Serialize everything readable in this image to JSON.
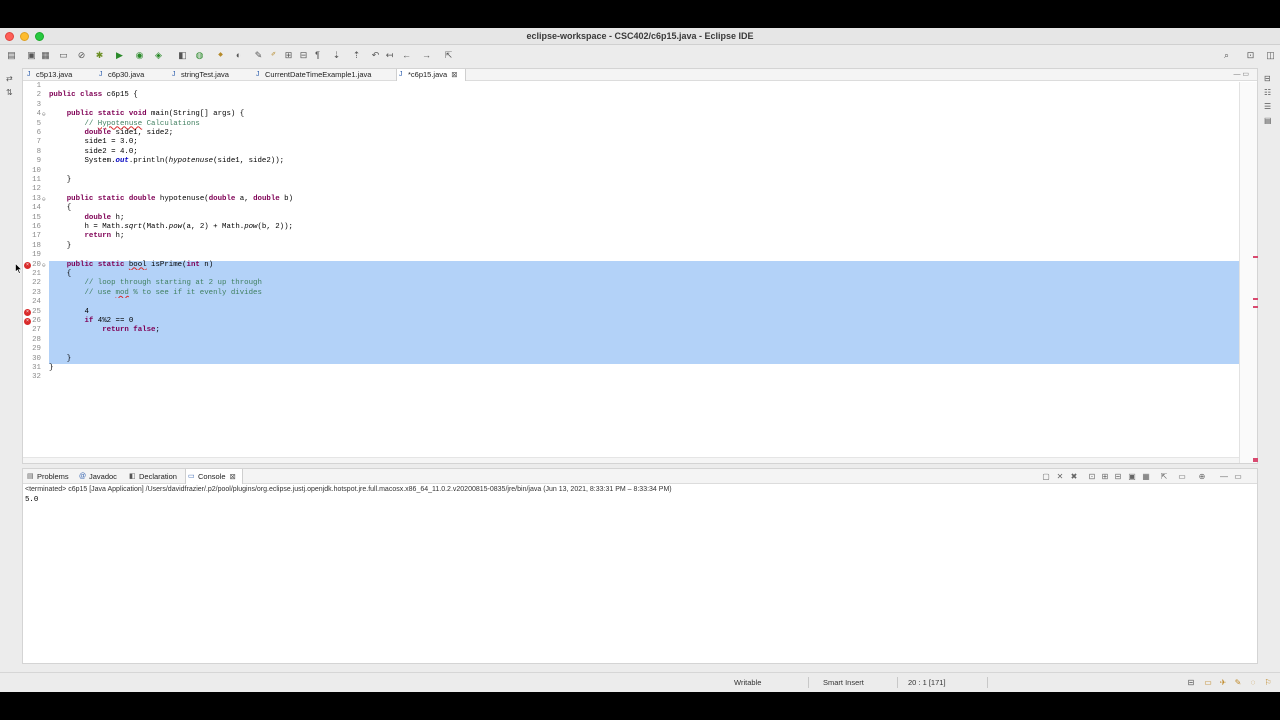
{
  "window": {
    "title": "eclipse-workspace - CSC402/c6p15.java - Eclipse IDE"
  },
  "editor": {
    "tabs": [
      {
        "label": "c5p13.java",
        "active": false
      },
      {
        "label": "c6p30.java",
        "active": false
      },
      {
        "label": "stringTest.java",
        "active": false
      },
      {
        "label": "CurrentDateTimeExample1.java",
        "active": false
      },
      {
        "label": "*c6p15.java",
        "active": true
      }
    ],
    "lines": [
      {
        "n": "1",
        "text": ""
      },
      {
        "n": "2",
        "text": "public class c6p15 {"
      },
      {
        "n": "3",
        "text": ""
      },
      {
        "n": "4",
        "text": "    public static void main(String[] args) {"
      },
      {
        "n": "5",
        "text": "        // Hypotenuse Calculations"
      },
      {
        "n": "6",
        "text": "        double side1, side2;"
      },
      {
        "n": "7",
        "text": "        side1 = 3.0;"
      },
      {
        "n": "8",
        "text": "        side2 = 4.0;"
      },
      {
        "n": "9",
        "text": "        System.out.println(hypotenuse(side1, side2));"
      },
      {
        "n": "10",
        "text": ""
      },
      {
        "n": "11",
        "text": "    }"
      },
      {
        "n": "12",
        "text": ""
      },
      {
        "n": "13",
        "text": "    public static double hypotenuse(double a, double b)"
      },
      {
        "n": "14",
        "text": "    {"
      },
      {
        "n": "15",
        "text": "        double h;"
      },
      {
        "n": "16",
        "text": "        h = Math.sqrt(Math.pow(a, 2) + Math.pow(b, 2));"
      },
      {
        "n": "17",
        "text": "        return h;"
      },
      {
        "n": "18",
        "text": "    }"
      },
      {
        "n": "19",
        "text": ""
      },
      {
        "n": "20",
        "text": "    public static bool isPrime(int n)"
      },
      {
        "n": "21",
        "text": "    {"
      },
      {
        "n": "22",
        "text": "        // loop through starting at 2 up through"
      },
      {
        "n": "23",
        "text": "        // use mod % to see if it evenly divides"
      },
      {
        "n": "24",
        "text": ""
      },
      {
        "n": "25",
        "text": "        4"
      },
      {
        "n": "26",
        "text": "        if 4%2 == 0"
      },
      {
        "n": "27",
        "text": "            return false;"
      },
      {
        "n": "28",
        "text": ""
      },
      {
        "n": "29",
        "text": ""
      },
      {
        "n": "30",
        "text": "    }"
      },
      {
        "n": "31",
        "text": "}"
      },
      {
        "n": "32",
        "text": ""
      }
    ]
  },
  "bottom": {
    "tabs": [
      {
        "label": "Problems",
        "icon": "problems-icon",
        "active": false
      },
      {
        "label": "Javadoc",
        "icon": "javadoc-icon",
        "active": false
      },
      {
        "label": "Declaration",
        "icon": "declaration-icon",
        "active": false
      },
      {
        "label": "Console",
        "icon": "console-icon",
        "active": true
      }
    ],
    "console_header": "<terminated> c6p15 [Java Application] /Users/davidfrazier/.p2/pool/plugins/org.eclipse.justj.openjdk.hotspot.jre.full.macosx.x86_64_11.0.2.v20200815-0835/jre/bin/java  (Jun 13, 2021, 8:33:31 PM – 8:33:34 PM)",
    "console_output": "5.0"
  },
  "status": {
    "writable": "Writable",
    "insert_mode": "Smart Insert",
    "position": "20 : 1 [171]"
  },
  "colors": {
    "selection": "#b3d2f8",
    "keyword": "#7f0055",
    "comment": "#3f7f5f",
    "error": "#d92b2b"
  }
}
